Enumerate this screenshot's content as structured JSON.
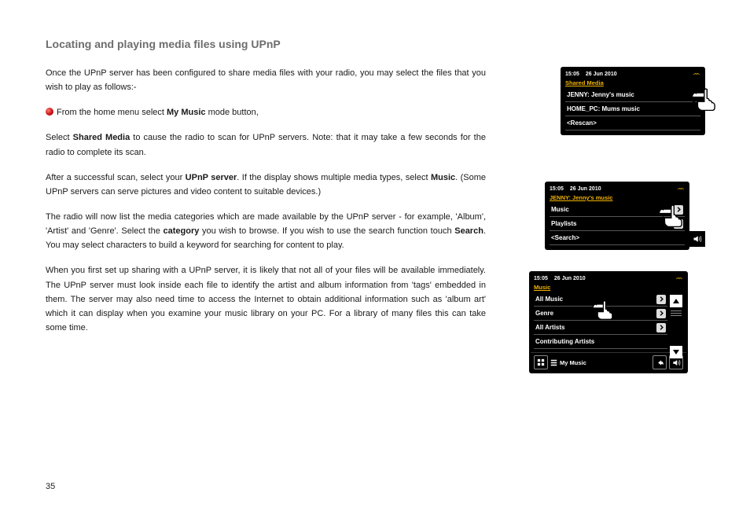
{
  "page": {
    "title": "Locating and playing media files using UPnP",
    "number": "35",
    "paragraphs": {
      "p1": "Once the UPnP server has been configured to share media files with your radio, you may select the files that you wish to play as follows:-",
      "p2a": "From the home menu select ",
      "p2b": " mode button,",
      "bold_mymusic": "My Music",
      "p3a": "Select ",
      "bold_shared": "Shared Media",
      "p3b": " to cause the radio to scan for UPnP servers. Note: that it may take a few seconds for the radio to complete its scan.",
      "p4a": "After a successful scan, select your ",
      "bold_upnp": "UPnP server",
      "p4b": ". If the display shows multiple media types, select ",
      "bold_music": "Music",
      "p4c": ". (Some UPnP servers can serve pictures and video content to suitable devices.)",
      "p5a": "The radio will now list the media categories which are made available by the UPnP server - for example, 'Album', 'Artist' and 'Genre'. Select the ",
      "bold_category": "category",
      "p5b": " you wish to browse. If you wish to use the search function touch ",
      "bold_search": "Search",
      "p5c": ". You may select characters to build a keyword for searching for content to play.",
      "p6": "When you first set up sharing with a UPnP server, it is likely that not all of your files will be available immediately. The UPnP server must look inside each file to identify the artist and album information from 'tags' embedded in them. The server may also need time to access the Internet to obtain additional information such as 'album art' which it can display when you examine your music library on your PC. For a library of many files this can take some time."
    }
  },
  "device": {
    "status": {
      "time": "15:05",
      "date": "26 Jun 2010"
    },
    "screen1": {
      "crumb": "Shared Media",
      "items": [
        "JENNY: Jenny's music",
        "HOME_PC: Mums music",
        "<Rescan>"
      ]
    },
    "screen2": {
      "crumb": "JENNY: Jenny's music",
      "items": [
        "Music",
        "Playlists",
        "<Search>"
      ]
    },
    "screen3": {
      "crumb": "Music",
      "items": [
        "All Music",
        "Genre",
        "All Artists",
        "Contributing Artists"
      ],
      "footer": "My Music"
    }
  }
}
